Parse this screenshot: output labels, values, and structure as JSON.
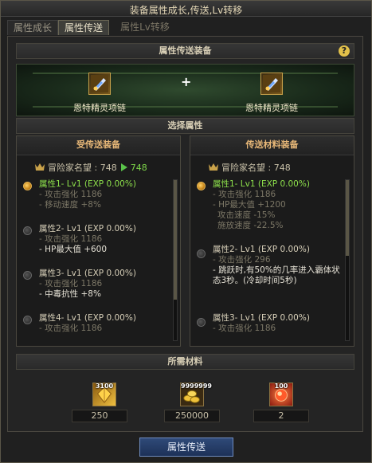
{
  "window": {
    "title": "装备属性成长,传送,Lv转移"
  },
  "tabs": [
    {
      "label": "属性成长"
    },
    {
      "label": "属性传送"
    },
    {
      "label": "属性Lv转移"
    }
  ],
  "sections": {
    "transfer_equipment": "属性传送装备",
    "select_attribute": "选择属性",
    "required_materials": "所需材料"
  },
  "items": {
    "left_name": "恩特精灵项链",
    "right_name": "恩特精灵项链",
    "plus": "+"
  },
  "receiver": {
    "header": "受传送装备",
    "reputation_label": "冒险家名望 :",
    "reputation_value": "748",
    "reputation_new": "748",
    "entries": [
      {
        "title": "属性1- Lv1 (EXP 0.00%)",
        "lines": [
          "- 攻击强化 1186",
          "- 移动速度 +8%"
        ]
      },
      {
        "title": "属性2- Lv1 (EXP 0.00%)",
        "lines": [
          "- 攻击强化 1186",
          "- HP最大值 +600"
        ]
      },
      {
        "title": "属性3- Lv1 (EXP 0.00%)",
        "lines": [
          "- 攻击强化 1186",
          "- 中毒抗性 +8%"
        ]
      },
      {
        "title": "属性4- Lv1 (EXP 0.00%)",
        "lines": [
          "- 攻击强化 1186"
        ]
      }
    ]
  },
  "source": {
    "header": "传送材料装备",
    "reputation_label": "冒险家名望 :",
    "reputation_value": "748",
    "entries": [
      {
        "title": "属性1- Lv1 (EXP 0.00%)",
        "lines": [
          "- 攻击强化 1186",
          "- HP最大值 +1200",
          "攻击速度 -15%",
          "施放速度 -22.5%"
        ]
      },
      {
        "title": "属性2- Lv1 (EXP 0.00%)",
        "lines": [
          "- 攻击强化 296",
          "- 跳跃时,有50%的几率进入霸体状态3秒。(冷却时间5秒)"
        ]
      },
      {
        "title": "属性3- Lv1 (EXP 0.00%)",
        "lines": [
          "- 攻击强化 1186"
        ]
      }
    ]
  },
  "materials": [
    {
      "icon": "gold-crystal-icon",
      "badge": "3100",
      "value": "250"
    },
    {
      "icon": "gold-coins-icon",
      "badge": "9999999",
      "value": "250000"
    },
    {
      "icon": "red-orb-icon",
      "badge": "100",
      "value": "2"
    }
  ],
  "button": {
    "label": "属性传送"
  },
  "colors": {
    "active_green": "#7fd84a",
    "header_orange": "#e8b878",
    "button_blue": "#2f4a78"
  }
}
